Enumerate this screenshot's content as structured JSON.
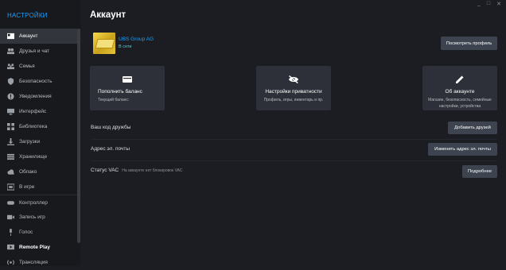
{
  "sidebar": {
    "title": "НАСТРОЙКИ",
    "items": [
      {
        "label": "Аккаунт",
        "icon": "account-icon",
        "active": true
      },
      {
        "label": "Друзья и чат",
        "icon": "friends-icon"
      },
      {
        "label": "Семья",
        "icon": "family-icon"
      },
      {
        "label": "Безопасность",
        "icon": "shield-icon"
      },
      {
        "label": "Уведомления",
        "icon": "notification-icon"
      },
      {
        "label": "Интерфейс",
        "icon": "monitor-icon"
      },
      {
        "label": "Библиотека",
        "icon": "library-grid-icon"
      },
      {
        "label": "Загрузки",
        "icon": "download-icon"
      },
      {
        "label": "Хранилище",
        "icon": "storage-icon"
      },
      {
        "label": "Облако",
        "icon": "cloud-icon"
      },
      {
        "label": "В игре",
        "icon": "in-game-icon"
      },
      {
        "label": "Контроллер",
        "icon": "controller-icon"
      },
      {
        "label": "Запись игр",
        "icon": "record-icon"
      },
      {
        "label": "Голос",
        "icon": "microphone-icon"
      },
      {
        "label": "Remote Play",
        "icon": "remote-play-icon"
      },
      {
        "label": "Трансляция",
        "icon": "broadcast-icon"
      }
    ]
  },
  "window": {
    "minimize": "_",
    "maximize": "□",
    "close": "✕"
  },
  "main": {
    "title": "Аккаунт",
    "user": {
      "name": "UBS Group AG",
      "status": "В сети"
    },
    "profile_button": "Посмотреть профиль",
    "cards": [
      {
        "title": "Пополнить баланс",
        "subtitle": "Текущий баланс:",
        "icon": "wallet-icon"
      },
      {
        "title": "Настройки приватности",
        "subtitle": "Профиль, игры, инвентарь и пр.",
        "icon": "eye-off-icon"
      },
      {
        "title": "Об аккаунте",
        "subtitle": "Магазин, безопасность, семейные настройки, устройства",
        "icon": "pencil-icon"
      }
    ],
    "rows": {
      "friend_code": {
        "label": "Ваш код дружбы",
        "button": "Добавить друзей"
      },
      "email": {
        "label": "Адрес эл. почты",
        "button": "Изменить адрес эл. почты"
      },
      "vac": {
        "label": "Статус VAC",
        "sub": "На аккаунте нет блокировок VAC",
        "button": "Подробнее"
      }
    }
  },
  "colors": {
    "accent": "#1a9fff",
    "background": "#1b1d22",
    "sidebar": "#17191d",
    "button": "#3d4450"
  }
}
